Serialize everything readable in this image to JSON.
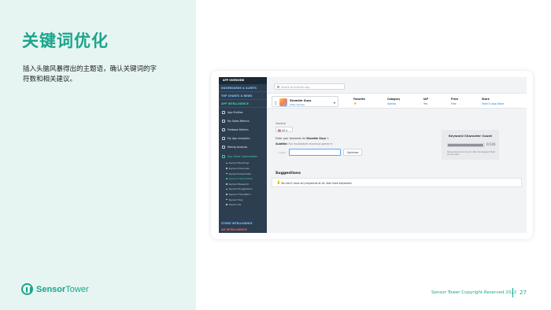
{
  "slide": {
    "title": "关键词优化",
    "description": "插入头脑风暴得出的主题语，确认关键词的字符数和相关建议。",
    "logo_text_bold": "Sensor",
    "logo_text_light": "Tower",
    "copyright": "Sensor Tower Copyright Reserved 2022",
    "page_number": "27",
    "accent_color": "#1aa58c"
  },
  "sidebar": {
    "header": "APP OVERVIEW",
    "sections": [
      {
        "label": "DASHBOARDS & ALERTS"
      },
      {
        "label": "TOP CHARTS & NEWS"
      },
      {
        "label": "APP INTELLIGENCE"
      }
    ],
    "items": [
      {
        "label": "App Profiles",
        "icon": "app-profiles-icon"
      },
      {
        "label": "My Sales Metrics",
        "icon": "sales-metrics-icon"
      },
      {
        "label": "Firebase Metrics",
        "icon": "firebase-icon"
      },
      {
        "label": "My App Analytics",
        "icon": "analytics-icon"
      },
      {
        "label": "Rating Analysis",
        "icon": "rating-icon"
      },
      {
        "label": "App Store Optimization",
        "icon": "aso-icon"
      }
    ],
    "subitems": [
      {
        "label": "Keyword Rankings"
      },
      {
        "label": "Keyword Overview"
      },
      {
        "label": "Keyword Downloads"
      },
      {
        "label": "Keyword Optimization"
      },
      {
        "label": "Keyword Research"
      },
      {
        "label": "Keyword Suggestions"
      },
      {
        "label": "Keyword Translation"
      },
      {
        "label": "Keyword Spy"
      },
      {
        "label": "Search Ads"
      }
    ],
    "bottom_section_1": "STORE INTELLIGENCE",
    "bottom_section_2": "AD INTELLIGENCE"
  },
  "main": {
    "search_placeholder": "Switch to another app",
    "app": {
      "platform_icon": "apple-icon",
      "name": "Stumble Guys",
      "publisher": "Kitka Games"
    },
    "meta": [
      {
        "key": "Favorite",
        "value": "★",
        "type": "star"
      },
      {
        "key": "Category",
        "value": "Games",
        "type": "link"
      },
      {
        "key": "IAP",
        "value": "Yes",
        "type": "text"
      },
      {
        "key": "Price",
        "value": "Free",
        "type": "text"
      },
      {
        "key": "Store",
        "value": "View in App Store",
        "type": "link"
      }
    ],
    "country_label": "Country:",
    "country_value": "🇺🇸 US ▾",
    "keywords_prefix": "Enter your keywords for",
    "keywords_app": "Stumble Guys",
    "subtitle_label": "Subtitle:",
    "subtitle_value": "Fun multiplayer knockout games",
    "keyword_row_num": "1 (set)",
    "optimize_button": "Optimize",
    "kcc": {
      "title": "Keyword Character Count",
      "value": "0/100",
      "fill_fraction": 0.98,
      "note": "Shows how much of your 100-char keyword field you've used"
    },
    "suggestions_title": "Suggestions",
    "suggestions_text": "You don't have any keywords at all. Add more keywords!"
  }
}
